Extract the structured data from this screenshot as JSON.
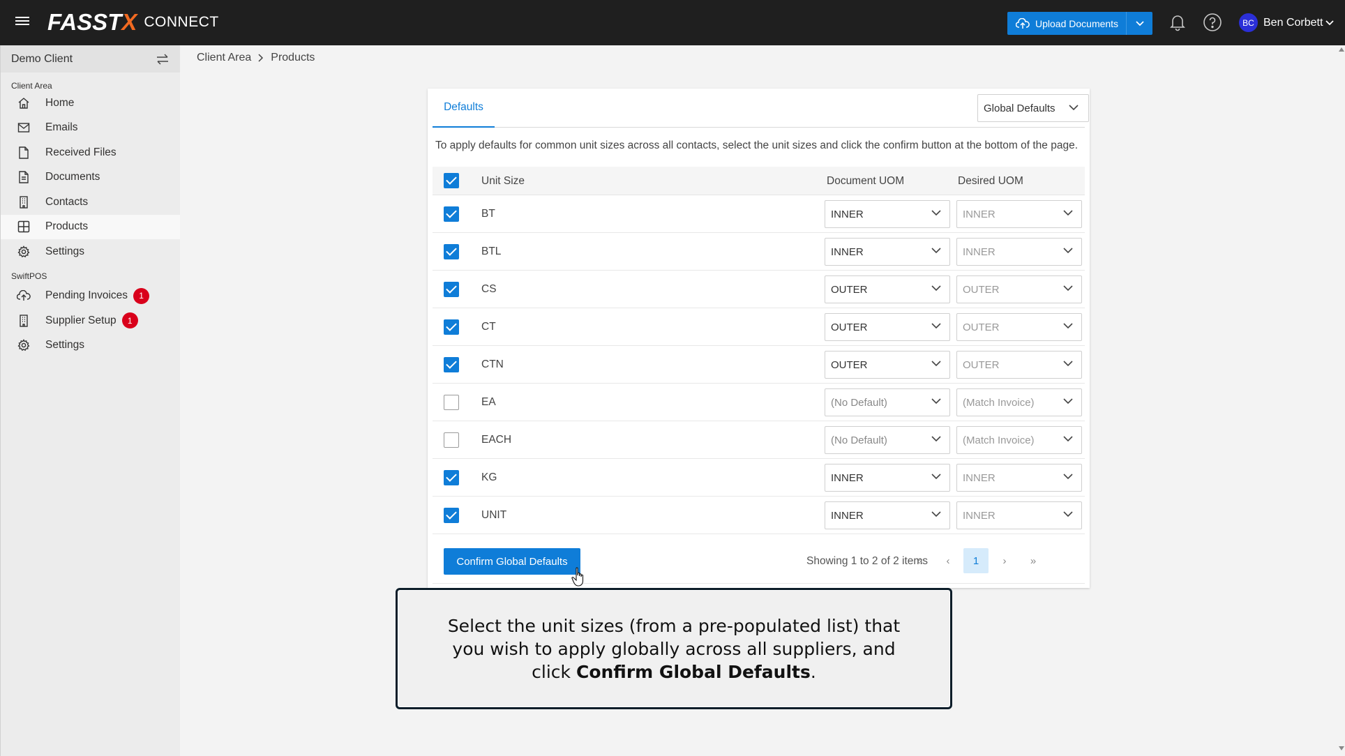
{
  "topbar": {
    "brand_main": "FASST",
    "brand_x": "X",
    "brand_sub": "CONNECT",
    "upload_label": "Upload Documents",
    "user_initials": "BC",
    "user_name": "Ben Corbett",
    "icons": [
      "menu-icon",
      "cloud-upload-icon",
      "chevron-down-icon",
      "bell-icon",
      "help-icon"
    ]
  },
  "sidebar": {
    "client_name": "Demo Client",
    "section_client_area": "Client Area",
    "client_items": [
      {
        "label": "Home",
        "icon": "home-icon"
      },
      {
        "label": "Emails",
        "icon": "mail-icon"
      },
      {
        "label": "Received Files",
        "icon": "file-icon"
      },
      {
        "label": "Documents",
        "icon": "document-icon"
      },
      {
        "label": "Contacts",
        "icon": "building-icon"
      },
      {
        "label": "Products",
        "icon": "grid-icon",
        "active": true
      },
      {
        "label": "Settings",
        "icon": "gear-icon"
      }
    ],
    "section_swiftpos": "SwiftPOS",
    "swiftpos_items": [
      {
        "label": "Pending Invoices",
        "icon": "cloud-upload-icon",
        "badge": "1"
      },
      {
        "label": "Supplier Setup",
        "icon": "building-icon",
        "badge": "1"
      },
      {
        "label": "Settings",
        "icon": "gear-icon"
      }
    ]
  },
  "breadcrumb": {
    "parent": "Client Area",
    "current": "Products"
  },
  "defaults": {
    "tab_label": "Defaults",
    "scope_selected": "Global Defaults",
    "instructions": "To apply defaults for common unit sizes across all contacts, select the unit sizes and click the confirm button at the bottom of the page.",
    "headers": {
      "unit_size": "Unit Size",
      "document_uom": "Document UOM",
      "desired_uom": "Desired UOM"
    },
    "rows": [
      {
        "unit": "BT",
        "checked": true,
        "doc": "INNER",
        "desired": "INNER"
      },
      {
        "unit": "BTL",
        "checked": true,
        "doc": "INNER",
        "desired": "INNER"
      },
      {
        "unit": "CS",
        "checked": true,
        "doc": "OUTER",
        "desired": "OUTER"
      },
      {
        "unit": "CT",
        "checked": true,
        "doc": "OUTER",
        "desired": "OUTER"
      },
      {
        "unit": "CTN",
        "checked": true,
        "doc": "OUTER",
        "desired": "OUTER"
      },
      {
        "unit": "EA",
        "checked": false,
        "doc": "(No Default)",
        "desired": "(Match Invoice)"
      },
      {
        "unit": "EACH",
        "checked": false,
        "doc": "(No Default)",
        "desired": "(Match Invoice)"
      },
      {
        "unit": "KG",
        "checked": true,
        "doc": "INNER",
        "desired": "INNER"
      },
      {
        "unit": "UNIT",
        "checked": true,
        "doc": "INNER",
        "desired": "INNER"
      }
    ],
    "confirm_label": "Confirm Global Defaults",
    "showing": "Showing 1 to 2 of 2 items",
    "pager": {
      "first": "«",
      "prev": "‹",
      "page": "1",
      "next": "›",
      "last": "»"
    }
  },
  "callout": {
    "text_before": "Select the unit sizes (from a pre-populated list) that you wish to apply globally across all suppliers, and click",
    "bold": "Confirm Global Defaults",
    "text_after": "."
  },
  "colors": {
    "accent": "#0f7dd8",
    "topbar": "#1f1f1f",
    "badge": "#d9001b",
    "brand_x": "#f26a21"
  }
}
